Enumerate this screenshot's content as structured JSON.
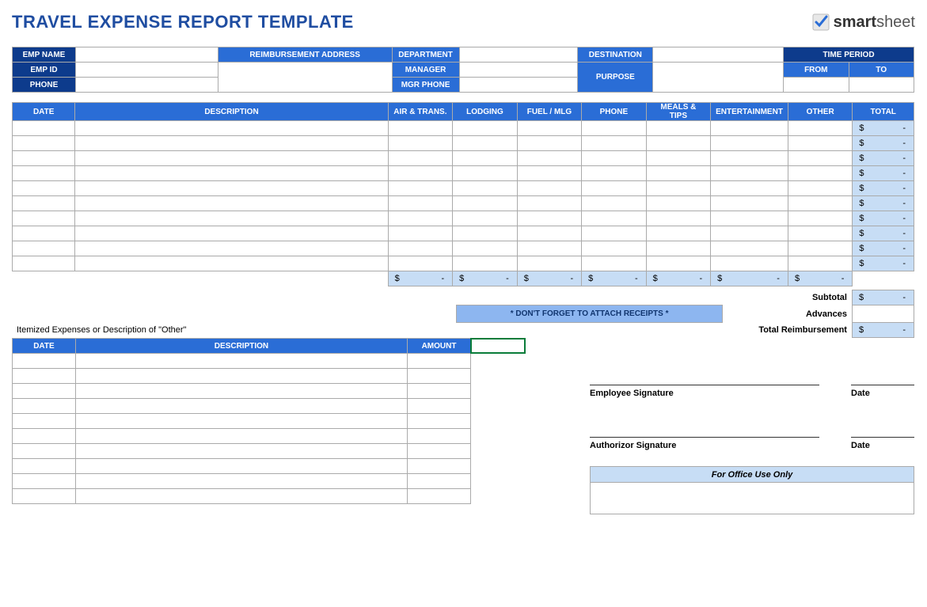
{
  "title": "TRAVEL EXPENSE REPORT TEMPLATE",
  "brand": {
    "name": "smartsheet",
    "bold_part": "smart",
    "light_part": "sheet"
  },
  "info_labels": {
    "emp_name": "EMP NAME",
    "emp_id": "EMP ID",
    "phone": "PHONE",
    "reimb_addr": "REIMBURSEMENT ADDRESS",
    "department": "DEPARTMENT",
    "manager": "MANAGER",
    "mgr_phone": "MGR PHONE",
    "destination": "DESTINATION",
    "purpose": "PURPOSE",
    "time_period": "TIME PERIOD",
    "from": "FROM",
    "to": "TO"
  },
  "info_values": {
    "emp_name": "",
    "emp_id": "",
    "phone": "",
    "reimb_addr": "",
    "department": "",
    "manager": "",
    "mgr_phone": "",
    "destination": "",
    "purpose": "",
    "from": "",
    "to": ""
  },
  "expense_headers": [
    "DATE",
    "DESCRIPTION",
    "AIR & TRANS.",
    "LODGING",
    "FUEL / MLG",
    "PHONE",
    "MEALS & TIPS",
    "ENTERTAINMENT",
    "OTHER",
    "TOTAL"
  ],
  "expense_rows": [
    {
      "date": "",
      "desc": "",
      "air": "",
      "lodging": "",
      "fuel": "",
      "phone": "",
      "meals": "",
      "ent": "",
      "other": "",
      "total_sym": "$",
      "total_val": "-"
    },
    {
      "date": "",
      "desc": "",
      "air": "",
      "lodging": "",
      "fuel": "",
      "phone": "",
      "meals": "",
      "ent": "",
      "other": "",
      "total_sym": "$",
      "total_val": "-"
    },
    {
      "date": "",
      "desc": "",
      "air": "",
      "lodging": "",
      "fuel": "",
      "phone": "",
      "meals": "",
      "ent": "",
      "other": "",
      "total_sym": "$",
      "total_val": "-"
    },
    {
      "date": "",
      "desc": "",
      "air": "",
      "lodging": "",
      "fuel": "",
      "phone": "",
      "meals": "",
      "ent": "",
      "other": "",
      "total_sym": "$",
      "total_val": "-"
    },
    {
      "date": "",
      "desc": "",
      "air": "",
      "lodging": "",
      "fuel": "",
      "phone": "",
      "meals": "",
      "ent": "",
      "other": "",
      "total_sym": "$",
      "total_val": "-"
    },
    {
      "date": "",
      "desc": "",
      "air": "",
      "lodging": "",
      "fuel": "",
      "phone": "",
      "meals": "",
      "ent": "",
      "other": "",
      "total_sym": "$",
      "total_val": "-"
    },
    {
      "date": "",
      "desc": "",
      "air": "",
      "lodging": "",
      "fuel": "",
      "phone": "",
      "meals": "",
      "ent": "",
      "other": "",
      "total_sym": "$",
      "total_val": "-"
    },
    {
      "date": "",
      "desc": "",
      "air": "",
      "lodging": "",
      "fuel": "",
      "phone": "",
      "meals": "",
      "ent": "",
      "other": "",
      "total_sym": "$",
      "total_val": "-"
    },
    {
      "date": "",
      "desc": "",
      "air": "",
      "lodging": "",
      "fuel": "",
      "phone": "",
      "meals": "",
      "ent": "",
      "other": "",
      "total_sym": "$",
      "total_val": "-"
    },
    {
      "date": "",
      "desc": "",
      "air": "",
      "lodging": "",
      "fuel": "",
      "phone": "",
      "meals": "",
      "ent": "",
      "other": "",
      "total_sym": "$",
      "total_val": "-"
    }
  ],
  "column_totals": [
    {
      "sym": "$",
      "val": "-"
    },
    {
      "sym": "$",
      "val": "-"
    },
    {
      "sym": "$",
      "val": "-"
    },
    {
      "sym": "$",
      "val": "-"
    },
    {
      "sym": "$",
      "val": "-"
    },
    {
      "sym": "$",
      "val": "-"
    },
    {
      "sym": "$",
      "val": "-"
    }
  ],
  "receipt_notice": "* DON'T FORGET TO ATTACH RECEIPTS *",
  "summary": {
    "subtotal_label": "Subtotal",
    "subtotal_sym": "$",
    "subtotal_val": "-",
    "advances_label": "Advances",
    "advances_val": "",
    "reimb_label": "Total Reimbursement",
    "reimb_sym": "$",
    "reimb_val": "-"
  },
  "itemized_label": "Itemized Expenses or Description of \"Other\"",
  "itemized_headers": [
    "DATE",
    "DESCRIPTION",
    "AMOUNT"
  ],
  "itemized_rows": [
    {
      "date": "",
      "desc": "",
      "amount": ""
    },
    {
      "date": "",
      "desc": "",
      "amount": ""
    },
    {
      "date": "",
      "desc": "",
      "amount": ""
    },
    {
      "date": "",
      "desc": "",
      "amount": ""
    },
    {
      "date": "",
      "desc": "",
      "amount": ""
    },
    {
      "date": "",
      "desc": "",
      "amount": ""
    },
    {
      "date": "",
      "desc": "",
      "amount": ""
    },
    {
      "date": "",
      "desc": "",
      "amount": ""
    },
    {
      "date": "",
      "desc": "",
      "amount": ""
    },
    {
      "date": "",
      "desc": "",
      "amount": ""
    }
  ],
  "signatures": {
    "employee": "Employee Signature",
    "authorizor": "Authorizor Signature",
    "date": "Date",
    "office_use": "For Office Use Only"
  }
}
